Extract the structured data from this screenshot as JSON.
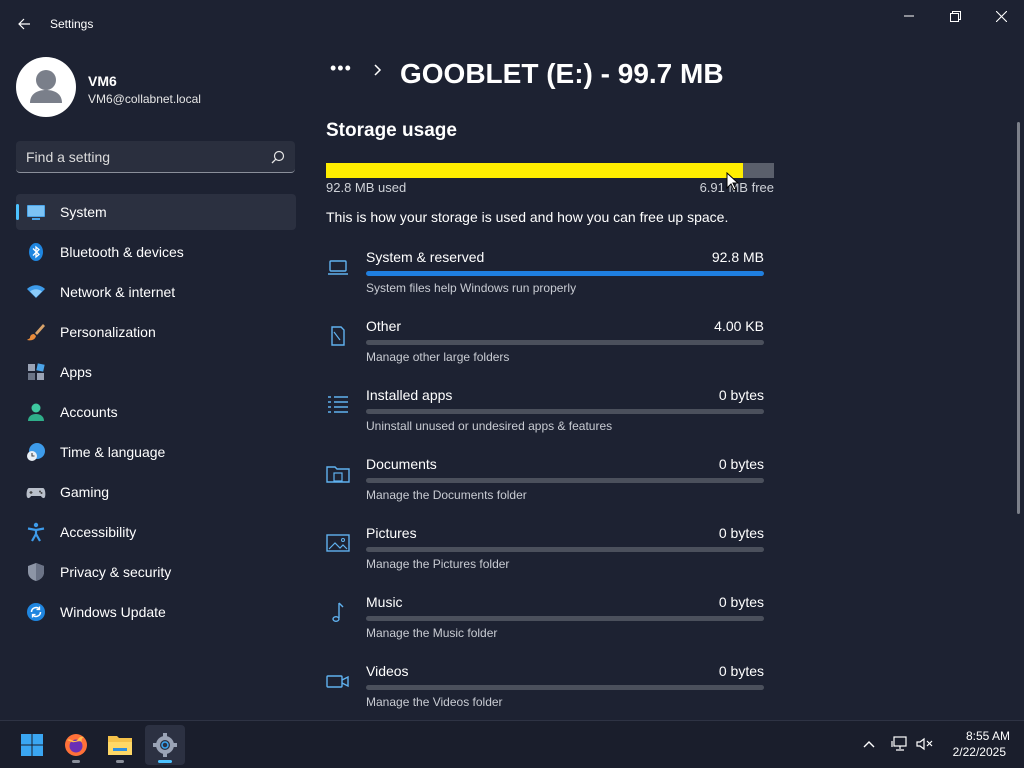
{
  "window": {
    "title": "Settings",
    "back_icon": "back-arrow-icon",
    "controls": [
      "minimize-icon",
      "maximize-icon",
      "close-icon"
    ]
  },
  "user": {
    "name": "VM6",
    "email": "VM6@collabnet.local"
  },
  "search": {
    "placeholder": "Find a setting",
    "icon": "search-icon"
  },
  "sidebar": {
    "items": [
      {
        "label": "System",
        "icon": "system-monitor-icon",
        "selected": true
      },
      {
        "label": "Bluetooth & devices",
        "icon": "bluetooth-icon"
      },
      {
        "label": "Network & internet",
        "icon": "wifi-icon"
      },
      {
        "label": "Personalization",
        "icon": "paintbrush-icon"
      },
      {
        "label": "Apps",
        "icon": "apps-icon"
      },
      {
        "label": "Accounts",
        "icon": "person-icon"
      },
      {
        "label": "Time & language",
        "icon": "globe-clock-icon"
      },
      {
        "label": "Gaming",
        "icon": "gamepad-icon"
      },
      {
        "label": "Accessibility",
        "icon": "accessibility-icon"
      },
      {
        "label": "Privacy & security",
        "icon": "shield-icon"
      },
      {
        "label": "Windows Update",
        "icon": "update-icon"
      }
    ]
  },
  "header": {
    "breadcrumb_overflow": "•••",
    "title": "GOOBLET (E:) - 99.7 MB"
  },
  "storage": {
    "section_title": "Storage usage",
    "used_label": "92.8 MB used",
    "free_label": "6.91 MB free",
    "used_fraction": 0.931,
    "fill_color": "#ffee00",
    "description": "This is how your storage is used and how you can free up space.",
    "categories": [
      {
        "name": "System & reserved",
        "size": "92.8 MB",
        "desc": "System files help Windows run properly",
        "fraction": 1.0,
        "icon": "laptop-icon"
      },
      {
        "name": "Other",
        "size": "4.00 KB",
        "desc": "Manage other large folders",
        "fraction": 0,
        "icon": "document-icon"
      },
      {
        "name": "Installed apps",
        "size": "0 bytes",
        "desc": "Uninstall unused or undesired apps & features",
        "fraction": 0,
        "icon": "list-icon"
      },
      {
        "name": "Documents",
        "size": "0 bytes",
        "desc": "Manage the Documents folder",
        "fraction": 0,
        "icon": "folder-icon"
      },
      {
        "name": "Pictures",
        "size": "0 bytes",
        "desc": "Manage the Pictures folder",
        "fraction": 0,
        "icon": "picture-icon"
      },
      {
        "name": "Music",
        "size": "0 bytes",
        "desc": "Manage the Music folder",
        "fraction": 0,
        "icon": "music-note-icon"
      },
      {
        "name": "Videos",
        "size": "0 bytes",
        "desc": "Manage the Videos folder",
        "fraction": 0,
        "icon": "video-camera-icon"
      }
    ]
  },
  "taskbar": {
    "apps": [
      "windows-start-icon",
      "firefox-icon",
      "file-explorer-icon",
      "settings-gear-icon"
    ],
    "tray": [
      "chevron-up-icon",
      "network-icon",
      "volume-muted-icon"
    ],
    "time": "8:55 AM",
    "date": "2/22/2025"
  }
}
